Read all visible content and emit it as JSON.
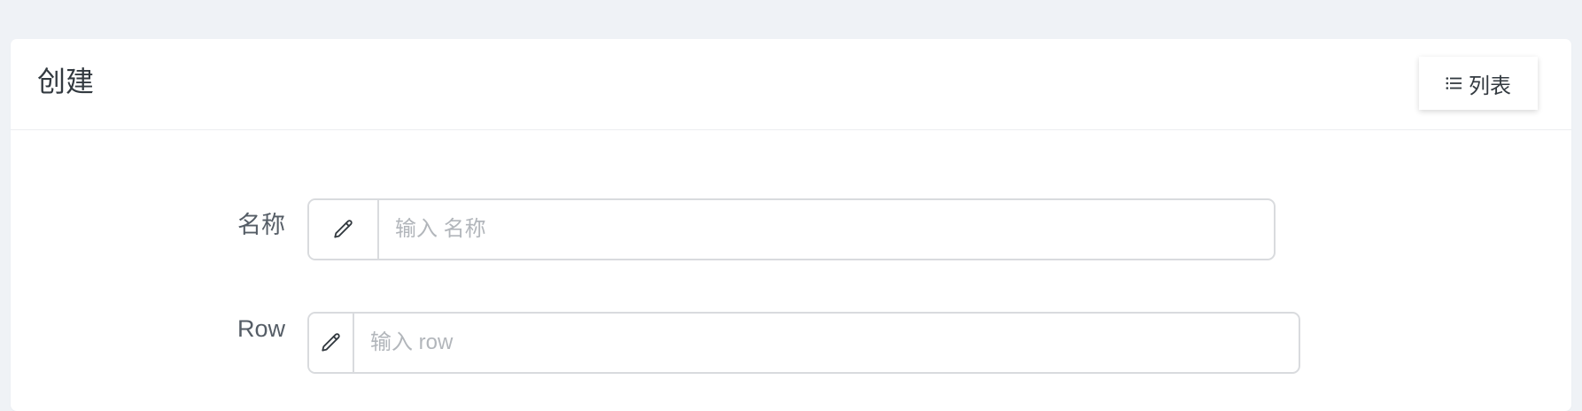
{
  "header": {
    "title": "创建",
    "list_button_label": "列表"
  },
  "form": {
    "fields": [
      {
        "label": "名称",
        "placeholder": "输入 名称",
        "value": "",
        "icon": "pencil-icon"
      },
      {
        "label": "Row",
        "placeholder": "输入 row",
        "value": "",
        "icon": "pencil-icon"
      }
    ]
  }
}
